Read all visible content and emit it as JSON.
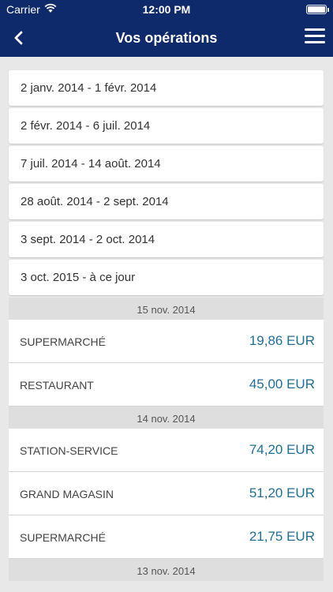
{
  "status_bar": {
    "carrier": "Carrier",
    "time": "12:00 PM"
  },
  "header": {
    "title": "Vos opérations"
  },
  "periods": [
    "2 janv. 2014 - 1 févr. 2014",
    "2 févr. 2014 - 6 juil. 2014",
    "7 juil. 2014 - 14 août. 2014",
    "28 août. 2014 - 2 sept. 2014",
    "3 sept. 2014 - 2 oct. 2014",
    "3 oct. 2015 - à ce jour"
  ],
  "groups": [
    {
      "date": "15 nov. 2014",
      "items": [
        {
          "label": "SUPERMARCHÉ",
          "amount": "19,86 EUR"
        },
        {
          "label": "RESTAURANT",
          "amount": "45,00 EUR"
        }
      ]
    },
    {
      "date": "14 nov. 2014",
      "items": [
        {
          "label": "STATION-SERVICE",
          "amount": "74,20 EUR"
        },
        {
          "label": "GRAND MAGASIN",
          "amount": "51,20 EUR"
        },
        {
          "label": "SUPERMARCHÉ",
          "amount": "21,75 EUR"
        }
      ]
    },
    {
      "date": "13 nov. 2014",
      "items": []
    }
  ],
  "colors": {
    "nav_bg": "#0f2a6b",
    "amount": "#1f6f96"
  },
  "icons": {
    "back": "chevron-left-icon",
    "menu": "hamburger-menu-icon",
    "wifi": "wifi-icon",
    "battery": "battery-icon"
  }
}
